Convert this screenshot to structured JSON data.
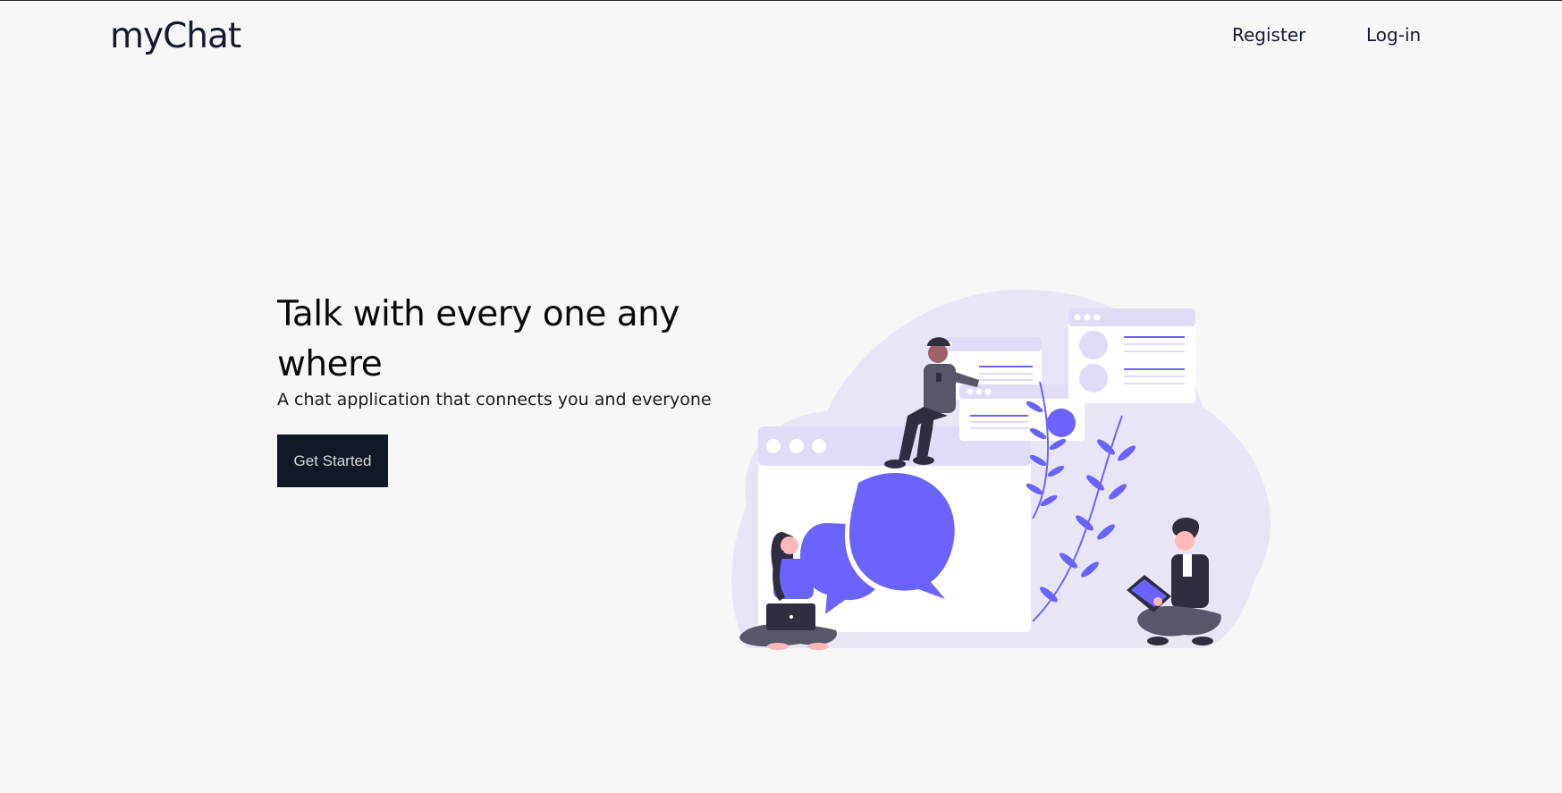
{
  "navbar": {
    "brand": "myChat",
    "links": [
      {
        "label": "Register"
      },
      {
        "label": "Log-in"
      }
    ]
  },
  "hero": {
    "title": "Talk with every one any where",
    "subtitle": "A chat application that connects you and everyone",
    "cta_label": "Get Started"
  },
  "colors": {
    "accent": "#6c63ff",
    "dark": "#111827",
    "background": "#f7f7f7",
    "blob": "#e8e6f6"
  },
  "illustration": {
    "icon": "chat-people-illustration"
  }
}
